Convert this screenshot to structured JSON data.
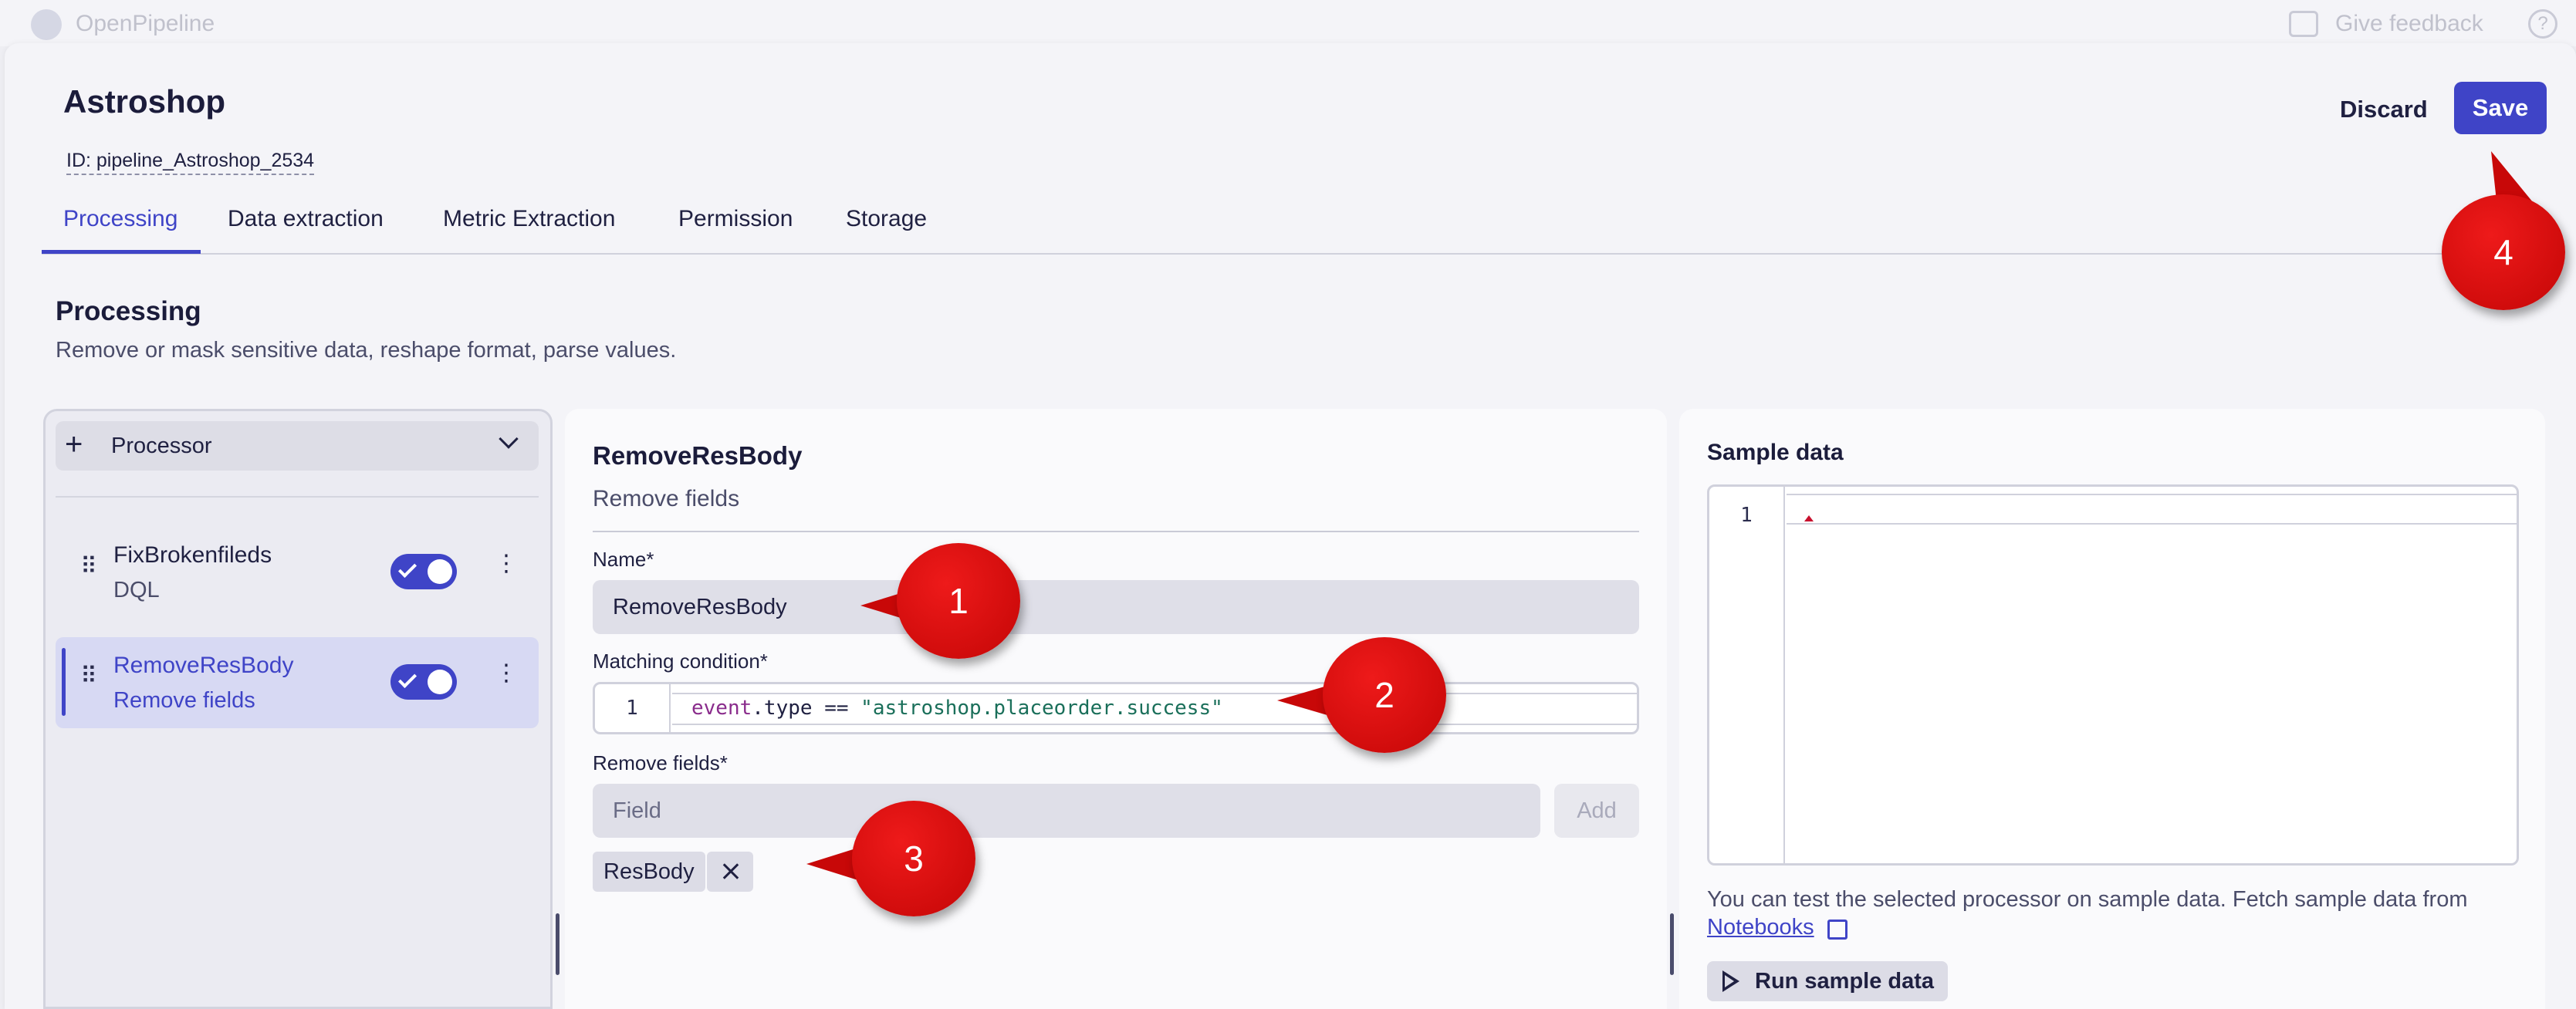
{
  "app": {
    "name": "OpenPipeline",
    "feedback": "Give feedback",
    "help": "?"
  },
  "header": {
    "title": "Astroshop",
    "id": "ID: pipeline_Astroshop_2534",
    "discard": "Discard",
    "save": "Save"
  },
  "tabs": [
    "Processing",
    "Data extraction",
    "Metric Extraction",
    "Permission",
    "Storage"
  ],
  "section": {
    "title": "Processing",
    "subtitle": "Remove or mask sensitive data, reshape format, parse values."
  },
  "processors": {
    "dropdown_label": "Processor",
    "items": [
      {
        "name": "FixBrokenfileds",
        "type": "DQL",
        "enabled": true
      },
      {
        "name": "RemoveResBody",
        "type": "Remove fields",
        "enabled": true
      }
    ]
  },
  "editor": {
    "title": "RemoveResBody",
    "subtitle": "Remove fields",
    "name_label": "Name*",
    "name_value": "RemoveResBody",
    "matching_label": "Matching condition*",
    "line_number": "1",
    "condition": {
      "kw": "event",
      "rest": ".type == ",
      "str": "\"astroshop.placeorder.success\""
    },
    "remove_label": "Remove fields*",
    "field_placeholder": "Field",
    "add": "Add",
    "chip": "ResBody"
  },
  "sample": {
    "title": "Sample data",
    "line_number": "1",
    "hint": "You can test the selected processor on sample data. Fetch sample data from",
    "link": "Notebooks",
    "run": "Run sample data"
  },
  "callouts": [
    "1",
    "2",
    "3",
    "4"
  ],
  "colors": {
    "accent": "#3f44c7",
    "callout": "#d40c0c"
  }
}
